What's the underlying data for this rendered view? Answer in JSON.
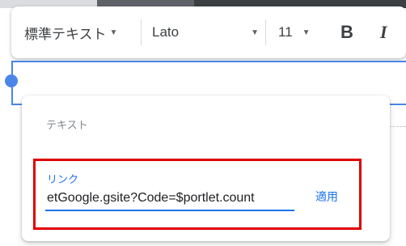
{
  "toolbar": {
    "paragraph_style": "標準テキスト",
    "font_family": "Lato",
    "font_size": "11",
    "bold_label": "B",
    "italic_label": "I"
  },
  "link_popup": {
    "text_field_label": "テキスト",
    "link_label": "リンク",
    "link_value": "etGoogle.gsite?Code=$portlet.count",
    "apply_label": "適用"
  },
  "colors": {
    "accent": "#1a73e8",
    "highlight_box": "#e00000",
    "selection_outline": "#4a86e8"
  }
}
